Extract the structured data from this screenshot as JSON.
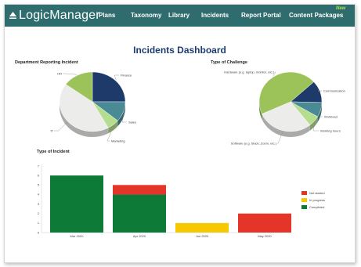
{
  "app": {
    "logo_text": "LogicManager",
    "nav": [
      {
        "label": "Plans"
      },
      {
        "label": "Taxonomy"
      },
      {
        "label": "Library"
      },
      {
        "label": "Incidents"
      },
      {
        "label": "Report Portal"
      },
      {
        "label": "Content Packages"
      }
    ],
    "new_badge": "New"
  },
  "dashboard": {
    "title": "Incidents Dashboard"
  },
  "colors": {
    "nav_bg": "#2f6c6e",
    "title": "#1c3b6e",
    "navy": "#1e3a6b",
    "teal": "#4a8a94",
    "lime": "#9cc35a",
    "light_green": "#b5dd8f",
    "offwhite": "#ececea",
    "green": "#0e7a37",
    "red": "#e53428",
    "yellow": "#f6c800"
  },
  "chart_data": [
    {
      "type": "pie",
      "title": "Department Reporting Incident",
      "slices": [
        {
          "label": "Finance",
          "value": 25,
          "color": "#1e3a6b"
        },
        {
          "label": "Sales",
          "value": 11,
          "color": "#4a8a94"
        },
        {
          "label": "Marketing",
          "value": 6,
          "color": "#b5dd8f"
        },
        {
          "label": "IT",
          "value": 43,
          "color": "#ececea"
        },
        {
          "label": "HR",
          "value": 15,
          "color": "#9cc35a"
        }
      ]
    },
    {
      "type": "pie",
      "title": "Type of Challenge",
      "slices": [
        {
          "label": "Communication",
          "value": 12,
          "color": "#1e3a6b"
        },
        {
          "label": "Workload",
          "value": 8,
          "color": "#4a8a94"
        },
        {
          "label": "Working hours",
          "value": 6,
          "color": "#b5dd8f"
        },
        {
          "label": "Software (e.g. Slack, Zoom, etc.)",
          "value": 29,
          "color": "#ececea"
        },
        {
          "label": "Hardware (e.g. laptop, monitor, etc.)",
          "value": 45,
          "color": "#9cc35a"
        }
      ]
    },
    {
      "type": "bar",
      "title": "Type of Incident",
      "categories": [
        "Mar 2020",
        "Apr 2020",
        "Jun 2020",
        "May 2020"
      ],
      "series": [
        {
          "name": "Completed",
          "color": "#0e7a37",
          "values": [
            6,
            4,
            0,
            0
          ]
        },
        {
          "name": "In progress",
          "color": "#f6c800",
          "values": [
            0,
            0,
            1,
            0
          ]
        },
        {
          "name": "Not started",
          "color": "#e53428",
          "values": [
            0,
            1,
            0,
            2
          ]
        }
      ],
      "legend_order": [
        "Not started",
        "In progress",
        "Completed"
      ],
      "ylim": [
        0,
        7
      ],
      "yticks": [
        0,
        1,
        2,
        3,
        4,
        5,
        6,
        7
      ],
      "stacked": true,
      "legend_position": "right"
    }
  ]
}
